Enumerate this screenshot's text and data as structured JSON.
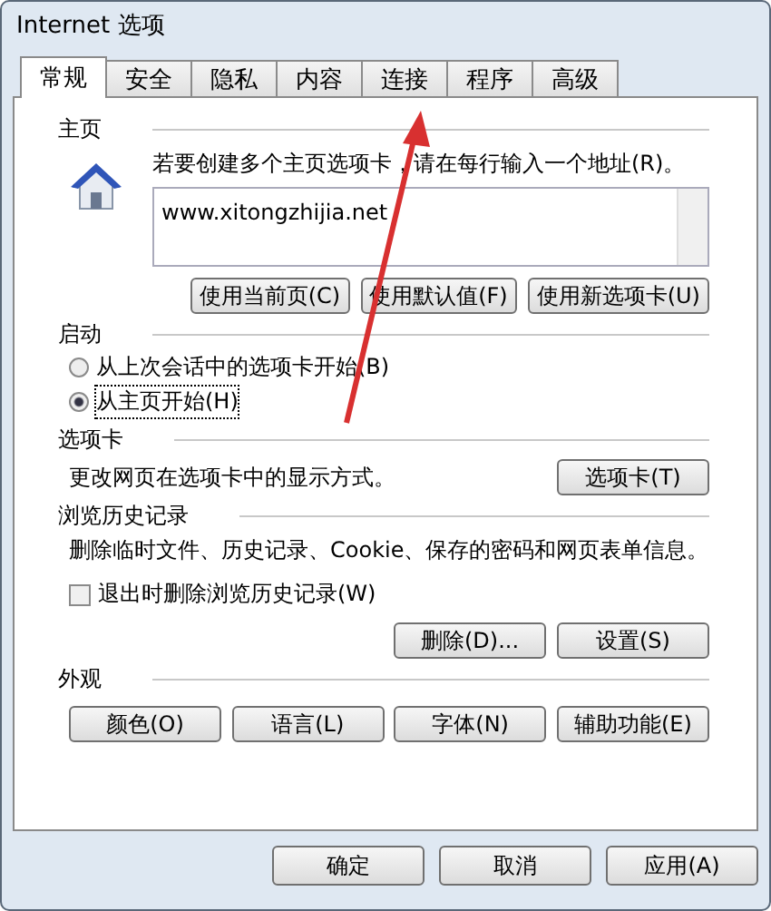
{
  "window": {
    "title": "Internet 选项"
  },
  "tabs": [
    {
      "label": "常规",
      "selected": true
    },
    {
      "label": "安全",
      "selected": false
    },
    {
      "label": "隐私",
      "selected": false
    },
    {
      "label": "内容",
      "selected": false
    },
    {
      "label": "连接",
      "selected": false
    },
    {
      "label": "程序",
      "selected": false
    },
    {
      "label": "高级",
      "selected": false
    }
  ],
  "home": {
    "heading": "主页",
    "hint": "若要创建多个主页选项卡，请在每行输入一个地址(R)。",
    "value": "www.xitongzhijia.net",
    "buttons": [
      "使用当前页(C)",
      "使用默认值(F)",
      "使用新选项卡(U)"
    ]
  },
  "startup": {
    "heading": "启动",
    "options": [
      {
        "label": "从上次会话中的选项卡开始(B)",
        "selected": false
      },
      {
        "label": "从主页开始(H)",
        "selected": true
      }
    ]
  },
  "tabs_section": {
    "heading": "选项卡",
    "text": "更改网页在选项卡中的显示方式。",
    "button": "选项卡(T)"
  },
  "history": {
    "heading": "浏览历史记录",
    "text": "删除临时文件、历史记录、Cookie、保存的密码和网页表单信息。",
    "checkbox": {
      "label": "退出时删除浏览历史记录(W)",
      "checked": false
    },
    "buttons": [
      "删除(D)...",
      "设置(S)"
    ]
  },
  "appearance": {
    "heading": "外观",
    "buttons": [
      "颜色(O)",
      "语言(L)",
      "字体(N)",
      "辅助功能(E)"
    ]
  },
  "footer": [
    "确定",
    "取消",
    "应用(A)"
  ]
}
